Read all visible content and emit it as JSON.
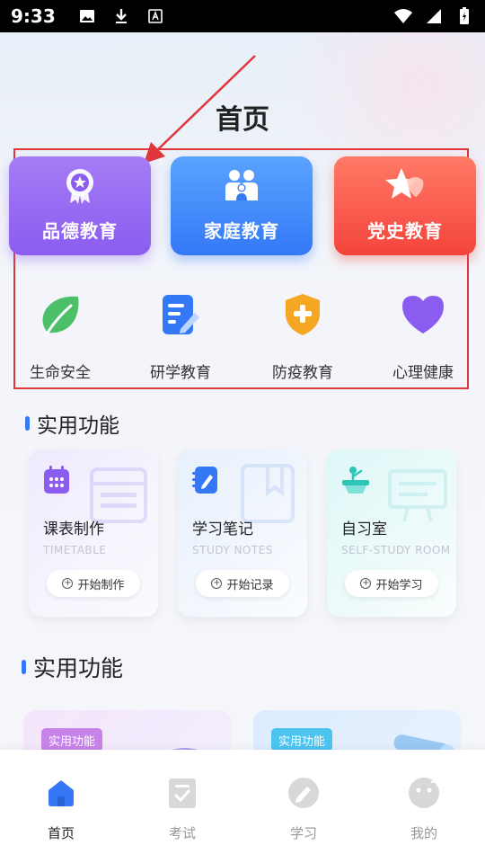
{
  "status_bar": {
    "time": "9:33",
    "icons": [
      "image-icon",
      "download-icon",
      "a-icon",
      "wifi-icon",
      "signal-icon",
      "battery-icon"
    ]
  },
  "header": {
    "title": "首页"
  },
  "category_cards": [
    {
      "label": "品德教育",
      "icon": "medal-icon",
      "color": "#8b5cf0"
    },
    {
      "label": "家庭教育",
      "icon": "family-icon",
      "color": "#3478f6"
    },
    {
      "label": "党史教育",
      "icon": "star-flag-icon",
      "color": "#f4443c"
    }
  ],
  "category_items": [
    {
      "label": "生命安全",
      "icon": "leaf-icon",
      "color": "#4cc069"
    },
    {
      "label": "研学教育",
      "icon": "notes-pen-icon",
      "color": "#3478f6"
    },
    {
      "label": "防疫教育",
      "icon": "shield-plus-icon",
      "color": "#f5a623"
    },
    {
      "label": "心理健康",
      "icon": "heart-icon",
      "color": "#8b5cf0"
    }
  ],
  "sections": [
    {
      "title": "实用功能"
    },
    {
      "title": "实用功能"
    }
  ],
  "function_cards": [
    {
      "title": "课表制作",
      "subtitle": "TIMETABLE",
      "button": "开始制作",
      "icon": "calendar-icon"
    },
    {
      "title": "学习笔记",
      "subtitle": "STUDY NOTES",
      "button": "开始记录",
      "icon": "notebook-icon"
    },
    {
      "title": "自习室",
      "subtitle": "SELF-STUDY ROOM",
      "button": "开始学习",
      "icon": "desk-lamp-icon"
    }
  ],
  "promo_cards": [
    {
      "tag": "实用功能"
    },
    {
      "tag": "实用功能"
    }
  ],
  "bottom_nav": [
    {
      "label": "首页",
      "icon": "home-icon",
      "active": true
    },
    {
      "label": "考试",
      "icon": "exam-icon",
      "active": false
    },
    {
      "label": "学习",
      "icon": "study-icon",
      "active": false
    },
    {
      "label": "我的",
      "icon": "profile-icon",
      "active": false
    }
  ],
  "colors": {
    "accent": "#3478f6",
    "annotation_red": "#e0363b"
  }
}
